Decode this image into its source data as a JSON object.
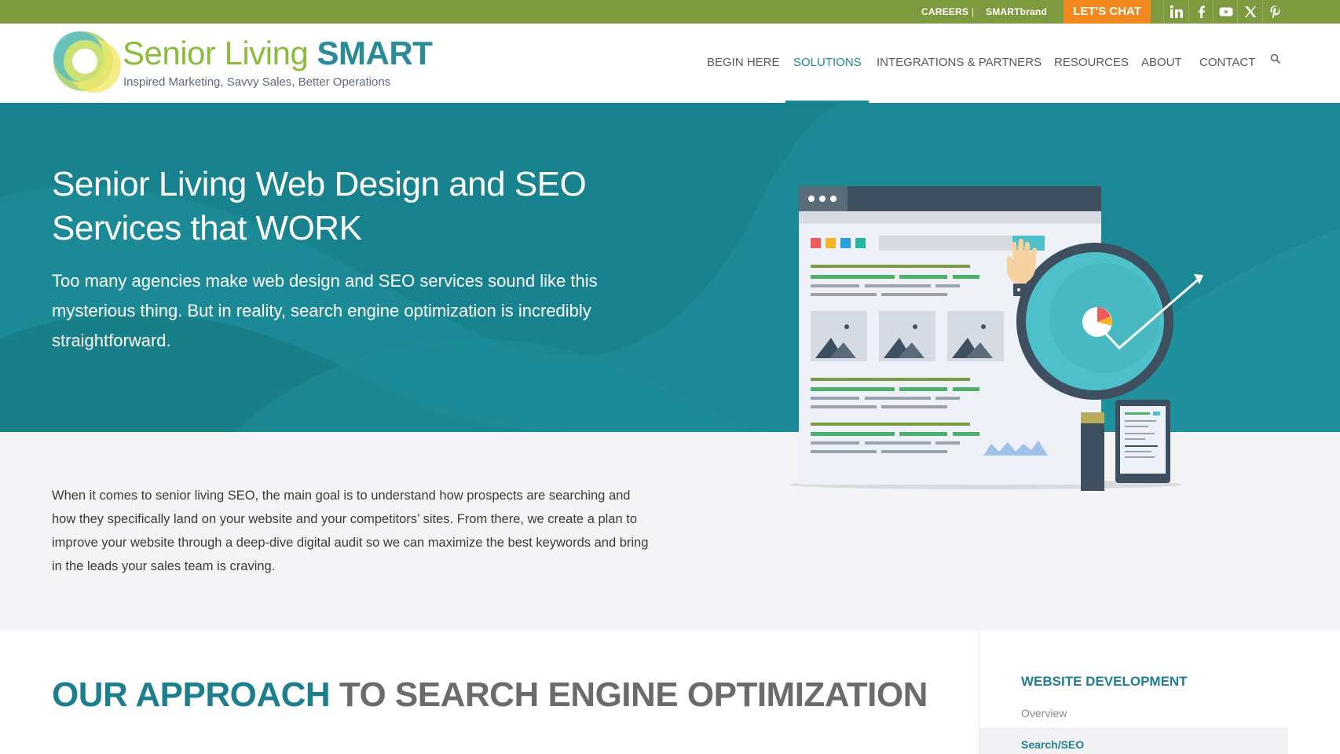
{
  "topbar": {
    "careers": "CAREERS",
    "separator": "|",
    "smartbrand": "SMARTbrand",
    "chat_button": "LET'S CHAT",
    "social": [
      "linkedin-icon",
      "facebook-icon",
      "youtube-icon",
      "x-icon",
      "pinterest-icon"
    ],
    "bg_color": "#7d9a3f",
    "chat_color": "#f2891f"
  },
  "logo": {
    "word1": "Senior Living ",
    "word2": "SMART",
    "tagline": "Inspired Marketing, Savvy Sales, Better Operations"
  },
  "nav": {
    "items": [
      "BEGIN HERE",
      "SOLUTIONS",
      "INTEGRATIONS & PARTNERS",
      "RESOURCES",
      "ABOUT",
      "CONTACT"
    ],
    "active": "SOLUTIONS",
    "search_icon": "search-icon"
  },
  "hero": {
    "title": "Senior Living Web Design and SEO Services that WORK",
    "subtitle": "Too many agencies make web design and SEO services sound like this mysterious thing. But in reality, search engine optimization is incredibly straightforward.",
    "bg_color": "#1b8a96"
  },
  "intro": {
    "text": "When it comes to senior living SEO, the main goal is to understand how prospects are searching and how they specifically land on your website and your competitors’ sites. From there, we create a plan to improve your website through a deep-dive digital audit so we can maximize the best keywords and bring in the leads your sales team is craving."
  },
  "approach": {
    "highlight": "OUR APPROACH",
    "rest": " TO SEARCH ENGINE OPTIMIZATION"
  },
  "sidebar": {
    "heading": "WEBSITE DEVELOPMENT",
    "links": [
      "Overview",
      "Search/SEO"
    ],
    "active": "Search/SEO"
  }
}
